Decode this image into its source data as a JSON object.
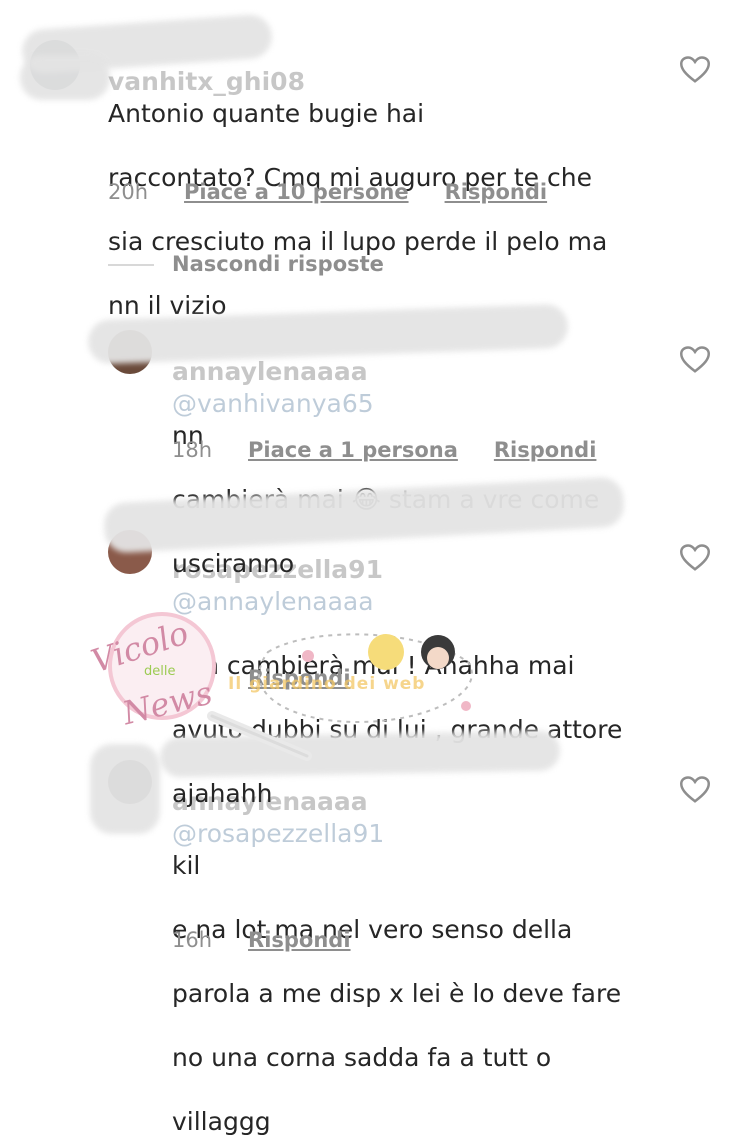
{
  "comments": [
    {
      "username": "vanhitx_ghi08",
      "text": "Antonio quante bugie hai raccontato? Cmq mi auguro per te che sia cresciuto ma il lupo perde il pelo ma nn il vizio",
      "line1": "Antonio quante bugie hai",
      "line2": "raccontato? Cmq mi auguro per te che",
      "line3": "sia cresciuto ma il lupo perde il pelo ma",
      "line4": "nn il vizio",
      "time": "20h",
      "likes": "Piace a 10 persone",
      "reply": "Rispondi"
    },
    {
      "username": "annaylenaaaa",
      "mention": "@vanhivanya65",
      "line1": "nn",
      "line2": "cambierà mai 😂 stam a vre come",
      "line3": "usciranno",
      "time": "18h",
      "likes": "Piace a 1 persona",
      "reply": "Rispondi"
    },
    {
      "username": "rosapezzella91",
      "mention": "@annaylenaaaa",
      "line1": "non cambierà mai ! Ahahha mai",
      "line2": "avuto dubbi su di lui , grande attore",
      "line3": "ajahahh",
      "time": "16h",
      "reply": "Rispondi"
    },
    {
      "username": "annaylenaaaa",
      "mention": "@rosapezzella91",
      "tail": "kil",
      "line1": "e na lot ma nel vero senso della",
      "line2": "parola a me disp x lei è lo deve fare",
      "line3": "no una corna sadda fa a tutt o",
      "line4": "villaggg",
      "time": "16h",
      "reply": "Rispondi"
    }
  ],
  "hide_replies": "Nascondi risposte",
  "watermark": {
    "title": "Vicolo",
    "middle": "delle",
    "bottom": "News",
    "right": "Il giardino dei web"
  },
  "colors": {
    "text": "#262626",
    "meta": "#8e8e8e",
    "redaction": "#e4e4e4"
  }
}
